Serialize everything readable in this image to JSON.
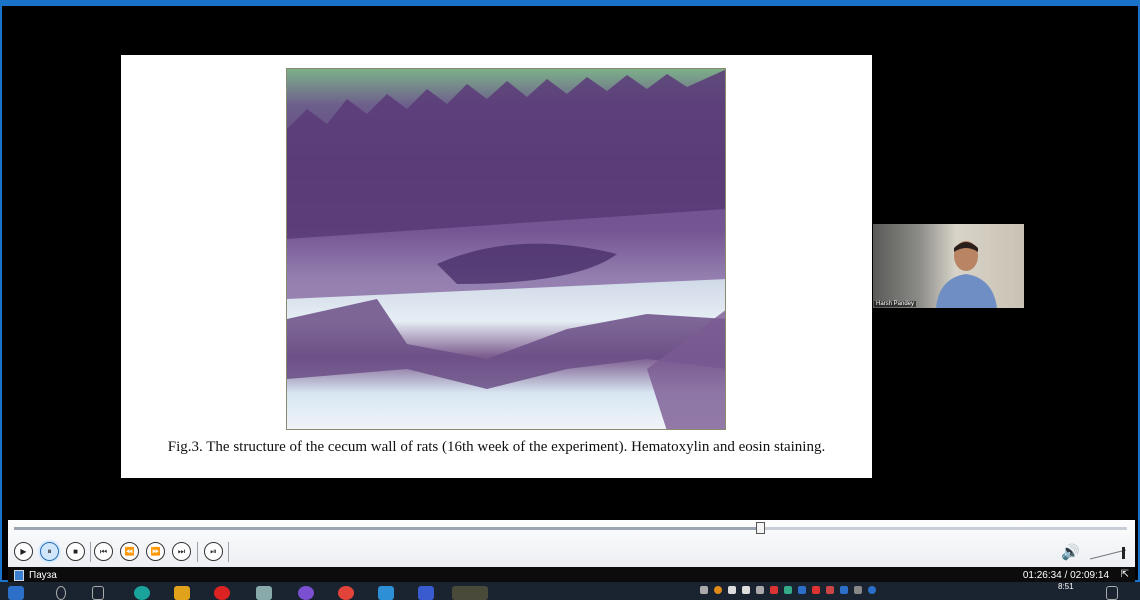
{
  "slide": {
    "caption": "Fig.3. The structure of the cecum wall of rats (16th week of the experiment). Hematoxylin and eosin staining."
  },
  "webcam": {
    "participant_name": "Harsh Pandey"
  },
  "player": {
    "seek_progress": 0.67,
    "buttons": [
      {
        "name": "play-icon",
        "glyph": "▶"
      },
      {
        "name": "pause-icon",
        "glyph": "⏸"
      },
      {
        "name": "stop-icon",
        "glyph": "■"
      },
      {
        "name": "previous-icon",
        "glyph": "⏮"
      },
      {
        "name": "rewind-icon",
        "glyph": "⏪"
      },
      {
        "name": "fast-forward-icon",
        "glyph": "⏩"
      },
      {
        "name": "next-icon",
        "glyph": "⏭"
      },
      {
        "name": "frame-step-icon",
        "glyph": "⏯"
      }
    ],
    "status_text": "Пауза",
    "time_display": "01:26:34 / 02:09:14",
    "mode_icon": "fullscreen-icon",
    "volume_icon": "speaker-icon"
  },
  "taskbar": {
    "clock": "8:51"
  }
}
